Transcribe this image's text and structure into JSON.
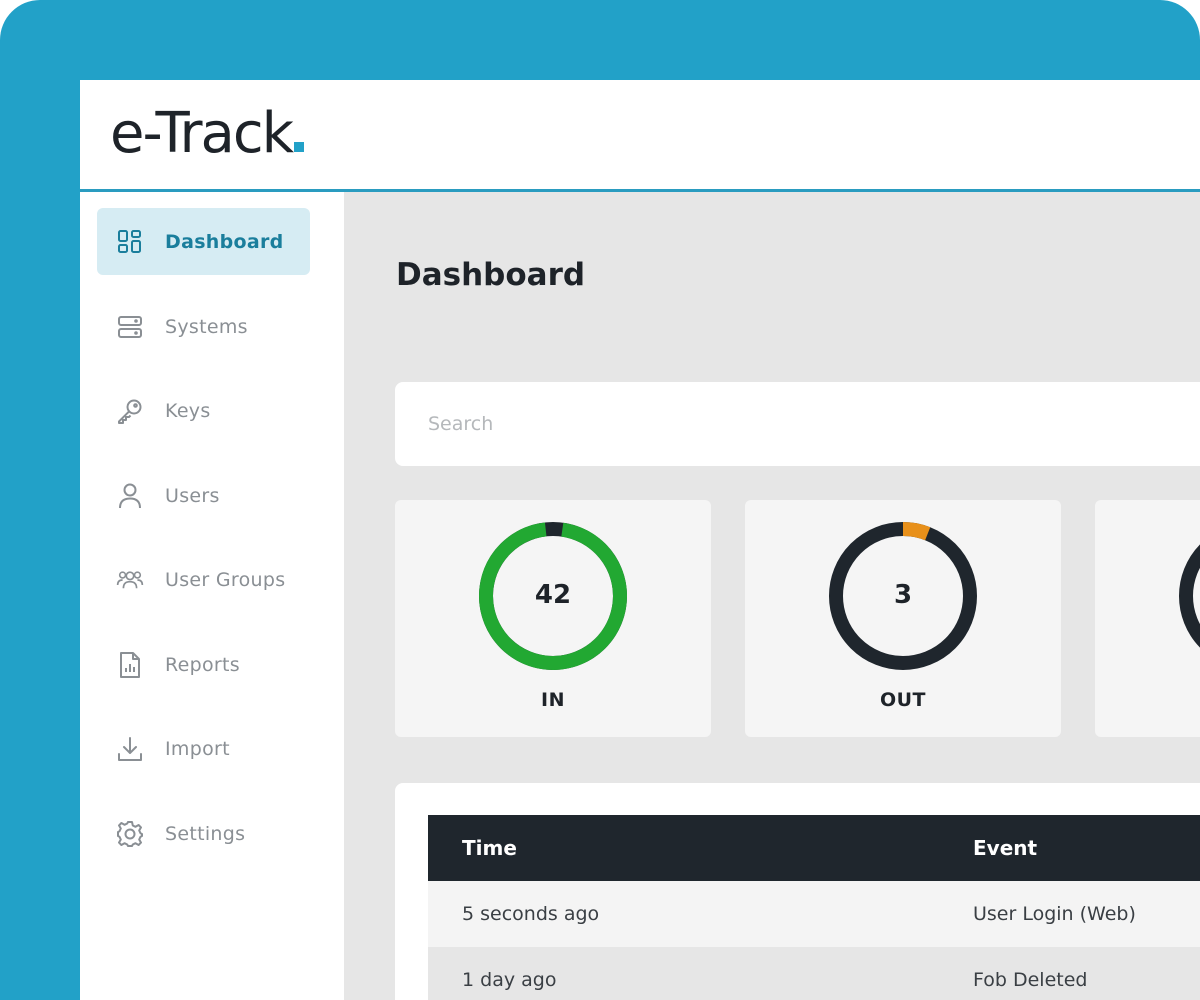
{
  "app": {
    "logo_text": "e-Track",
    "accent_color": "#22a1c8"
  },
  "sidebar": {
    "items": [
      {
        "label": "Dashboard",
        "icon": "dashboard-grid-icon",
        "active": true
      },
      {
        "label": "Systems",
        "icon": "server-icon",
        "active": false
      },
      {
        "label": "Keys",
        "icon": "key-icon",
        "active": false
      },
      {
        "label": "Users",
        "icon": "user-icon",
        "active": false
      },
      {
        "label": "User Groups",
        "icon": "user-group-icon",
        "active": false
      },
      {
        "label": "Reports",
        "icon": "report-icon",
        "active": false
      },
      {
        "label": "Import",
        "icon": "import-icon",
        "active": false
      },
      {
        "label": "Settings",
        "icon": "gear-icon",
        "active": false
      }
    ]
  },
  "main": {
    "title": "Dashboard",
    "search": {
      "placeholder": "Search",
      "value": ""
    },
    "stats": [
      {
        "value": "42",
        "label": "IN",
        "ring_fraction": 0.96,
        "ring_color": "#22a832",
        "base_color": "#1f262d"
      },
      {
        "value": "3",
        "label": "OUT",
        "ring_fraction": 0.06,
        "ring_color": "#e8901a",
        "base_color": "#1f262d"
      },
      {
        "value": "",
        "label": "",
        "ring_fraction": 0,
        "ring_color": "#1f262d",
        "base_color": "#1f262d"
      }
    ],
    "table": {
      "columns": [
        "Time",
        "Event"
      ],
      "rows": [
        [
          "5 seconds ago",
          "User Login (Web)"
        ],
        [
          "1 day ago",
          "Fob Deleted"
        ]
      ]
    }
  }
}
